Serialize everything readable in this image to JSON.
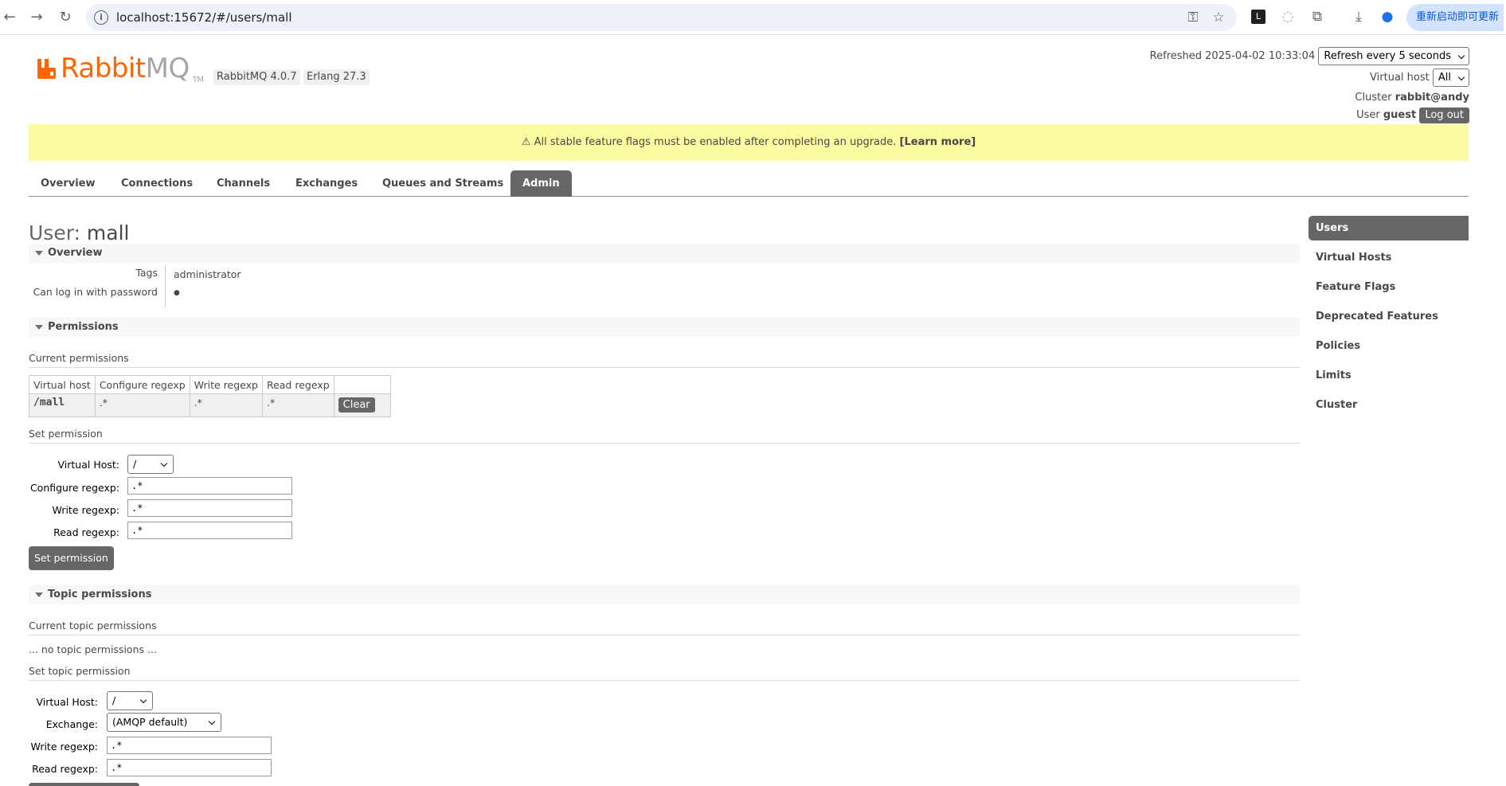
{
  "browser": {
    "url": "localhost:15672/#/users/mall",
    "update_label": "重新启动即可更新"
  },
  "app": {
    "logo_rabbit": "Rabbit",
    "logo_mq": "MQ",
    "logo_tm": "TM",
    "version": "RabbitMQ 4.0.7",
    "erlang": "Erlang 27.3",
    "brand_color": "#ff6600"
  },
  "status": {
    "refreshed_label": "Refreshed",
    "refreshed_time": "2025-04-02 10:33:04",
    "refresh_option": "Refresh every 5 seconds",
    "vhost_label": "Virtual host",
    "vhost_value": "All",
    "cluster_label": "Cluster",
    "cluster_value": "rabbit@andy",
    "user_label": "User",
    "user_value": "guest",
    "logout_label": "Log out"
  },
  "banner": {
    "warning_icon": "⚠",
    "text": "All stable feature flags must be enabled after completing an upgrade.",
    "link": "[Learn more]"
  },
  "tabs": [
    {
      "label": "Overview"
    },
    {
      "label": "Connections"
    },
    {
      "label": "Channels"
    },
    {
      "label": "Exchanges"
    },
    {
      "label": "Queues and Streams"
    },
    {
      "label": "Admin"
    }
  ],
  "page": {
    "title_label": "User:",
    "title_value": "mall"
  },
  "overview": {
    "heading": "Overview",
    "tags_label": "Tags",
    "tags_value": "administrator",
    "login_label": "Can log in with password",
    "login_value": "●"
  },
  "permissions": {
    "heading": "Permissions",
    "current_label": "Current permissions",
    "columns": [
      "Virtual host",
      "Configure regexp",
      "Write regexp",
      "Read regexp"
    ],
    "rows": [
      {
        "vhost": "/mall",
        "configure": ".*",
        "write": ".*",
        "read": ".*",
        "action": "Clear"
      }
    ],
    "set_label": "Set permission",
    "form": {
      "vhost_label": "Virtual Host:",
      "vhost_value": "/",
      "configure_label": "Configure regexp:",
      "configure_value": ".*",
      "write_label": "Write regexp:",
      "write_value": ".*",
      "read_label": "Read regexp:",
      "read_value": ".*",
      "submit": "Set permission"
    }
  },
  "topic": {
    "heading": "Topic permissions",
    "current_label": "Current topic permissions",
    "empty_text": "... no topic permissions ...",
    "set_label": "Set topic permission",
    "form": {
      "vhost_label": "Virtual Host:",
      "vhost_value": "/",
      "exchange_label": "Exchange:",
      "exchange_value": "(AMQP default)",
      "write_label": "Write regexp:",
      "write_value": ".*",
      "read_label": "Read regexp:",
      "read_value": ".*"
    }
  },
  "admin_nav": [
    {
      "label": "Users"
    },
    {
      "label": "Virtual Hosts"
    },
    {
      "label": "Feature Flags"
    },
    {
      "label": "Deprecated Features"
    },
    {
      "label": "Policies"
    },
    {
      "label": "Limits"
    },
    {
      "label": "Cluster"
    }
  ]
}
